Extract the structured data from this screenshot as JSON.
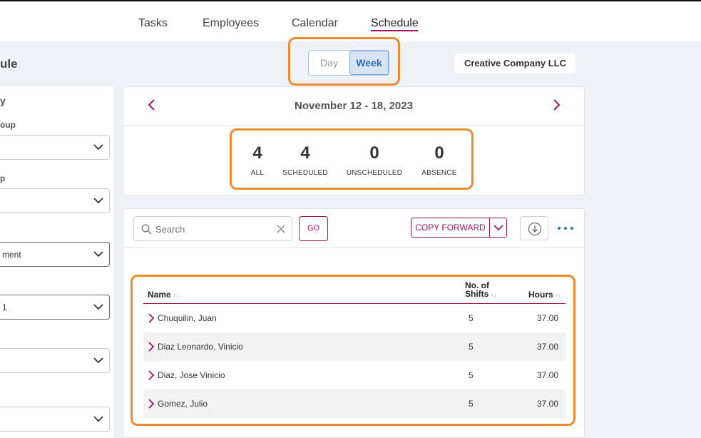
{
  "topnav": {
    "items": [
      {
        "label": "Tasks"
      },
      {
        "label": "Employees"
      },
      {
        "label": "Calendar"
      },
      {
        "label": "Schedule",
        "active": true
      }
    ]
  },
  "page": {
    "title_fragment": "ule"
  },
  "left_panel": {
    "section_fragment": "y",
    "fields": [
      {
        "label_fragment": "oup",
        "value": ""
      },
      {
        "label_fragment": "p",
        "value": ""
      },
      {
        "label_fragment": "",
        "value": "ment"
      },
      {
        "label_fragment": "",
        "value": "1"
      },
      {
        "label_fragment": "",
        "value": ""
      },
      {
        "label_fragment": "",
        "value": ""
      }
    ]
  },
  "view_toggle": {
    "day_label": "Day",
    "week_label": "Week",
    "selected": "Week"
  },
  "company": {
    "name": "Creative Company LLC"
  },
  "date_nav": {
    "range": "November 12 - 18, 2023"
  },
  "stats": [
    {
      "value": "4",
      "label": "ALL"
    },
    {
      "value": "4",
      "label": "SCHEDULED"
    },
    {
      "value": "0",
      "label": "UNSCHEDULED"
    },
    {
      "value": "0",
      "label": "ABSENCE"
    }
  ],
  "toolbar": {
    "search_placeholder": "Search",
    "search_value": "",
    "go_label": "GO",
    "copy_forward_label": "COPY FORWARD"
  },
  "table": {
    "headers": {
      "name": "Name",
      "shifts_line1": "No. of",
      "shifts_line2": "Shifts",
      "hours": "Hours"
    },
    "rows": [
      {
        "name": "Chuquilin, Juan",
        "shifts": "5",
        "hours": "37.00"
      },
      {
        "name": "Diaz Leonardo, Vinicio",
        "shifts": "5",
        "hours": "37.00"
      },
      {
        "name": "Diaz, Jose Vinicio",
        "shifts": "5",
        "hours": "37.00"
      },
      {
        "name": "Gomez, Julio",
        "shifts": "5",
        "hours": "37.00"
      }
    ]
  },
  "colors": {
    "accent": "#a0145d",
    "highlight": "#ee8a2e",
    "toggle_active_bg": "#d6e4f4",
    "toggle_active_text": "#2d6fb6"
  },
  "icons": [
    "chevron-left-icon",
    "chevron-right-icon",
    "search-icon",
    "clear-icon",
    "chevron-down-icon",
    "download-icon",
    "more-icon",
    "row-chevron-icon",
    "sort-icon"
  ]
}
